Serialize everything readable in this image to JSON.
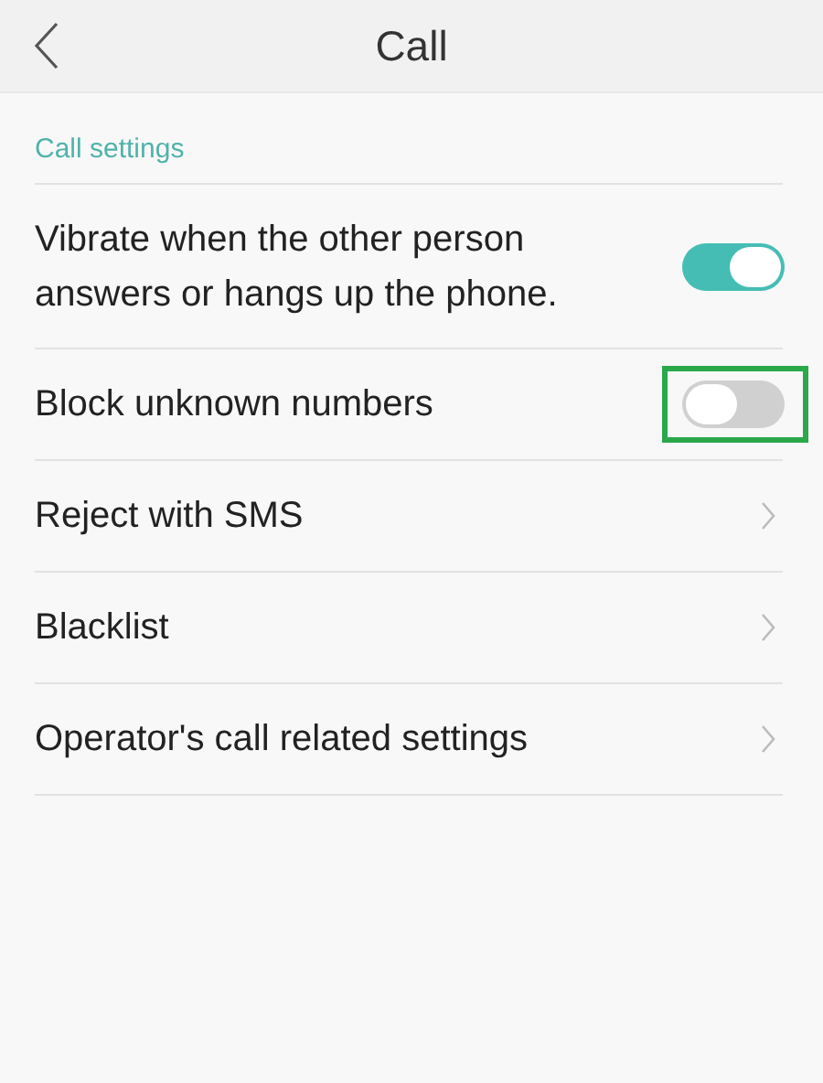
{
  "header": {
    "title": "Call"
  },
  "section": {
    "title": "Call settings"
  },
  "items": [
    {
      "kind": "toggle",
      "label": "Vibrate when the other person answers or hangs up the phone.",
      "on": true
    },
    {
      "kind": "toggle",
      "label": "Block unknown numbers",
      "on": false,
      "highlighted": true
    },
    {
      "kind": "link",
      "label": "Reject with SMS"
    },
    {
      "kind": "link",
      "label": "Blacklist"
    },
    {
      "kind": "link",
      "label": "Operator's call related settings"
    }
  ]
}
